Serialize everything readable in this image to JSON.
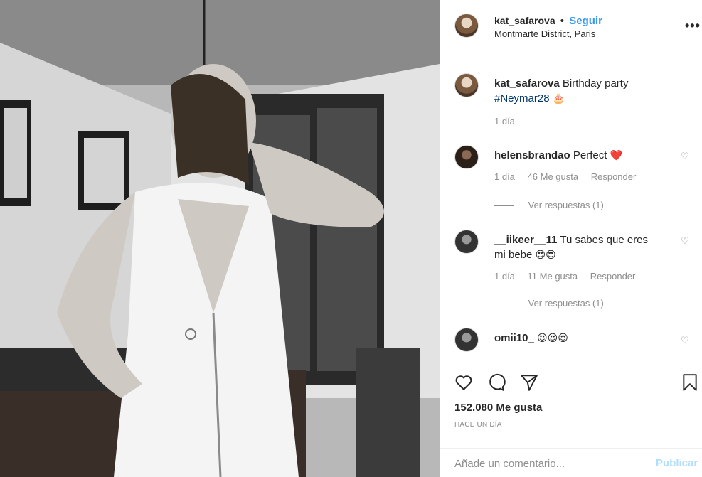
{
  "post": {
    "image_description_icon": "photo"
  },
  "header": {
    "username": "kat_safarova",
    "separator": "•",
    "follow_label": "Seguir",
    "location": "Montmarte District, Paris",
    "more_icon": "more-horizontal-icon",
    "more_label": "•••"
  },
  "caption": {
    "username": "kat_safarova",
    "text": "Birthday party",
    "hashtag": "#Neymar28",
    "emoji": "🎂",
    "time": "1 día"
  },
  "comments": [
    {
      "username": "helensbrandao",
      "text": "Perfect",
      "emoji": "❤️",
      "time": "1 día",
      "likes": "46 Me gusta",
      "reply_label": "Responder",
      "view_replies": "Ver respuestas (1)"
    },
    {
      "username": "__iikeer__11",
      "text": "Tu sabes que eres mi bebe",
      "emoji": "😍😍",
      "time": "1 día",
      "likes": "11 Me gusta",
      "reply_label": "Responder",
      "view_replies": "Ver respuestas (1)"
    },
    {
      "username": "omii10_",
      "text": "",
      "emoji": "😍😍😍"
    }
  ],
  "actions": {
    "like_icon": "heart-icon",
    "comment_icon": "comment-icon",
    "share_icon": "send-icon",
    "save_icon": "bookmark-icon",
    "likes_count": "152.080 Me gusta",
    "time_ago": "HACE UN DÍA"
  },
  "add_comment": {
    "placeholder": "Añade un comentario...",
    "publish_label": "Publicar"
  },
  "colors": {
    "accent": "#3897f0",
    "hashtag": "#003569",
    "publish_disabled": "#b2dffc",
    "muted": "#8e8e8e",
    "like_heart": "#ed4956"
  }
}
